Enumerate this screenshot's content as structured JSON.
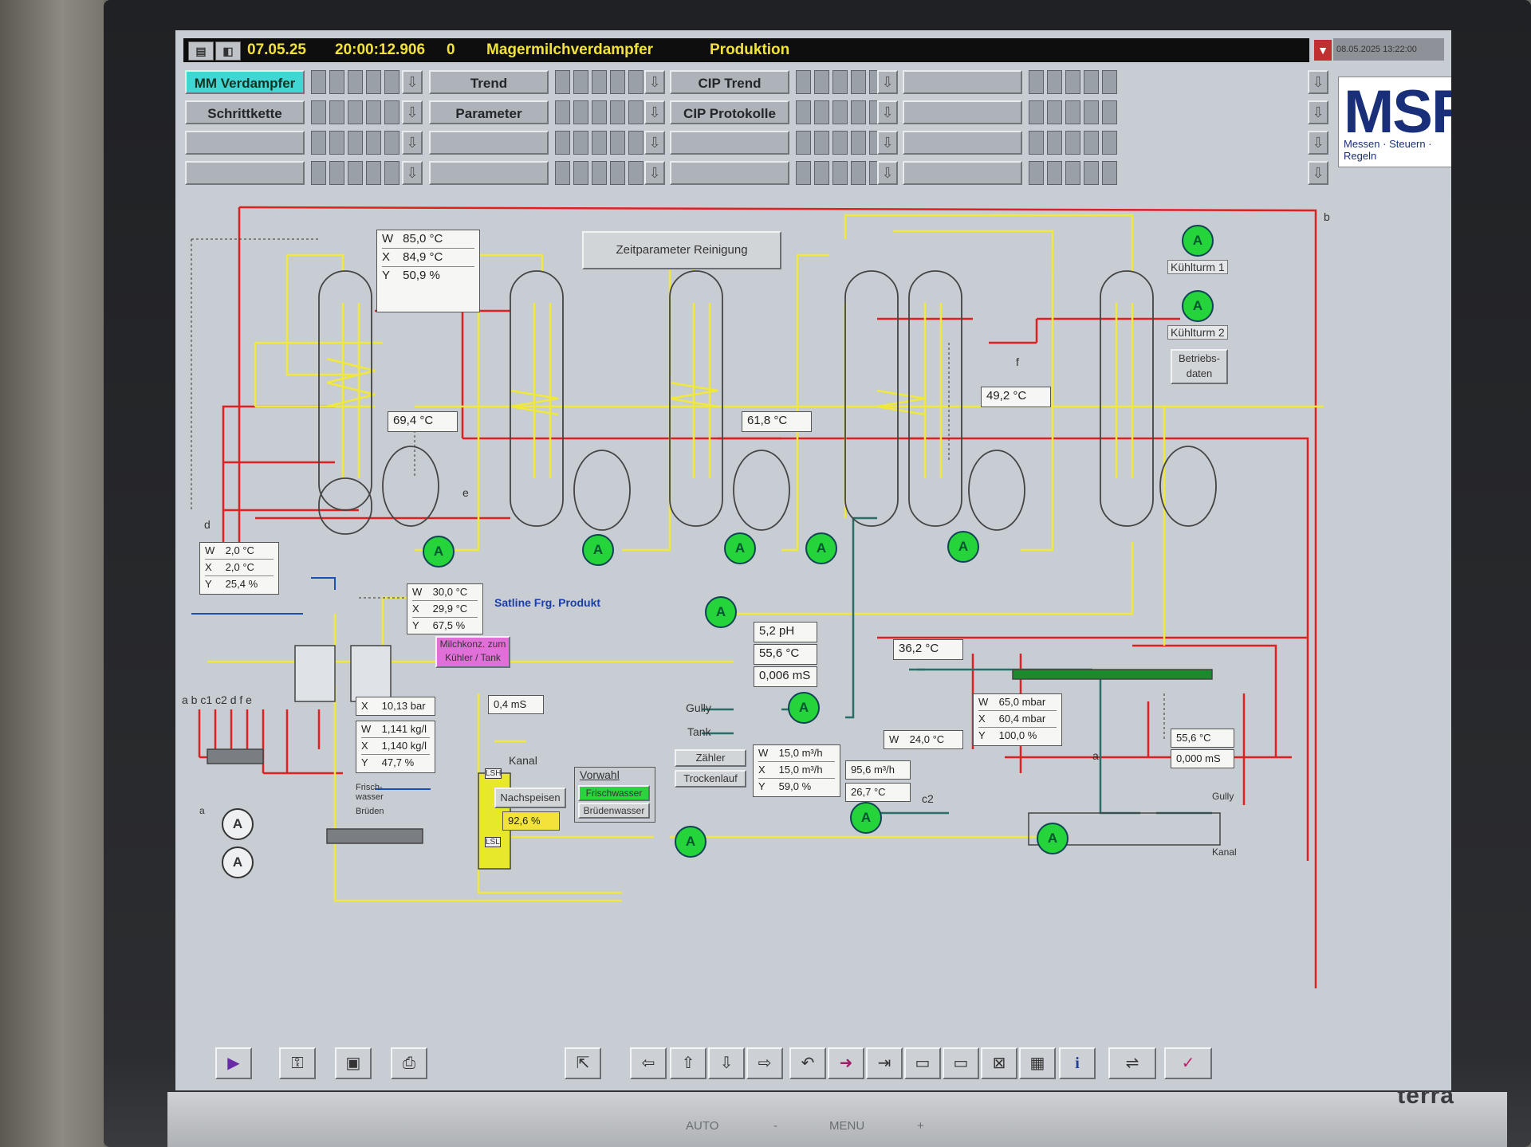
{
  "header": {
    "date": "07.05.25",
    "time": "20:00:12.906",
    "counter": "0",
    "title": "Magermilchverdampfer",
    "mode": "Produktion",
    "datetime_stamp": "08.05.2025 13:22:00"
  },
  "nav": {
    "col1": [
      "MM Verdampfer",
      "Schrittkette",
      "",
      ""
    ],
    "col2": [
      "Trend",
      "Parameter",
      "",
      ""
    ],
    "col3": [
      "CIP Trend",
      "CIP Protokolle",
      "",
      ""
    ],
    "col4": [
      "",
      "",
      "",
      ""
    ]
  },
  "logo": {
    "main": "MSR",
    "sub": "Messen · Steuern · Regeln"
  },
  "process": {
    "zeitparameter_button": "Zeitparameter Reinigung",
    "box1": {
      "w_key": "W",
      "w": "85,0",
      "w_unit": "°C",
      "x_key": "X",
      "x": "84,9",
      "x_unit": "°C",
      "y_key": "Y",
      "y": "50,9",
      "y_unit": "%"
    },
    "temp1": "69,4",
    "temp1_unit": "°C",
    "temp2": "61,8",
    "temp2_unit": "°C",
    "temp3": "49,2",
    "temp3_unit": "°C",
    "letter_e": "e",
    "letter_d": "d",
    "letter_b": "b",
    "letter_f": "f",
    "kuehlturm1": "Kühlturm 1",
    "kuehlturm2": "Kühlturm 2",
    "betriebsdaten": "Betriebs- daten",
    "box2": {
      "w_key": "W",
      "w": "2,0",
      "w_unit": "°C",
      "x_key": "X",
      "x": "2,0",
      "x_unit": "°C",
      "y_key": "Y",
      "y": "25,4",
      "y_unit": "%"
    },
    "box3": {
      "w_key": "W",
      "w": "30,0",
      "w_unit": "°C",
      "x_key": "X",
      "x": "29,9",
      "x_unit": "°C",
      "y_key": "Y",
      "y": "67,5",
      "y_unit": "%"
    },
    "satline": "Satline Frg. Produkt",
    "milchkonz": "Milchkonz. zum Kühler / Tank",
    "ph": "5,2",
    "ph_unit": "pH",
    "ph_temp": "55,6",
    "ph_temp_unit": "°C",
    "ph_cond": "0,006",
    "ph_cond_unit": "mS",
    "gully": "Gully",
    "tank": "Tank",
    "bar_box": {
      "x_key": "X",
      "x": "10,13",
      "x_unit": "bar"
    },
    "dens_box": {
      "w_key": "W",
      "w": "1,141",
      "w_unit": "kg/l",
      "x_key": "X",
      "x": "1,140",
      "x_unit": "kg/l",
      "y_key": "Y",
      "y": "47,7",
      "y_unit": "%"
    },
    "cond_small": "0,4",
    "cond_small_unit": "mS",
    "kanal": "Kanal",
    "frischwasser": "Frisch- wasser",
    "brueden": "Brüden",
    "lsh": "LSH",
    "lsl": "LSL",
    "nachspeisen": "Nachspeisen",
    "level": "92,6",
    "level_unit": "%",
    "vorwahl": "Vorwahl",
    "frischwasser_btn": "Frischwasser",
    "bruedenwasser_btn": "Brüdenwasser",
    "zaehler": "Zähler",
    "trockenlauf": "Trockenlauf",
    "flow_box": {
      "w_key": "W",
      "w": "15,0",
      "w_unit": "m³/h",
      "x_key": "X",
      "x": "15,0",
      "x_unit": "m³/h",
      "y_key": "Y",
      "y": "59,0",
      "y_unit": "%"
    },
    "flow2": "95,6",
    "flow2_unit": "m³/h",
    "temp_c2": "26,7",
    "temp_c2_unit": "°C",
    "temp4": "36,2",
    "temp4_unit": "°C",
    "mbar_box": {
      "w_key": "W",
      "w": "65,0",
      "w_unit": "mbar",
      "x_key": "X",
      "x": "60,4",
      "x_unit": "mbar",
      "y_key": "Y",
      "y": "100,0",
      "y_unit": "%"
    },
    "w24": {
      "w_key": "W",
      "w": "24,0",
      "w_unit": "°C"
    },
    "right_temp": "55,6",
    "right_temp_unit": "°C",
    "right_cond": "0,000",
    "right_cond_unit": "mS",
    "gully2": "Gully",
    "kanal2": "Kanal",
    "label_a": "a",
    "labels_bottom": "a  b  c1 c2     d   f     e",
    "letter_c2": "c2",
    "letter_a2": "a",
    "pump_A": "A"
  },
  "brand": "terra",
  "monitor_buttons": [
    "AUTO",
    "-",
    "MENU",
    "+"
  ],
  "colors": {
    "background": "#c8cdd3",
    "header": "#0e0e0e",
    "header_text": "#f2e23a",
    "selected_nav": "#3fd6d4",
    "pump": "#25d33b",
    "product_line": "#f0e83a",
    "steam_line": "#e02020",
    "cooling_line": "#2a6e6a",
    "level_bar": "#e8e82a"
  }
}
